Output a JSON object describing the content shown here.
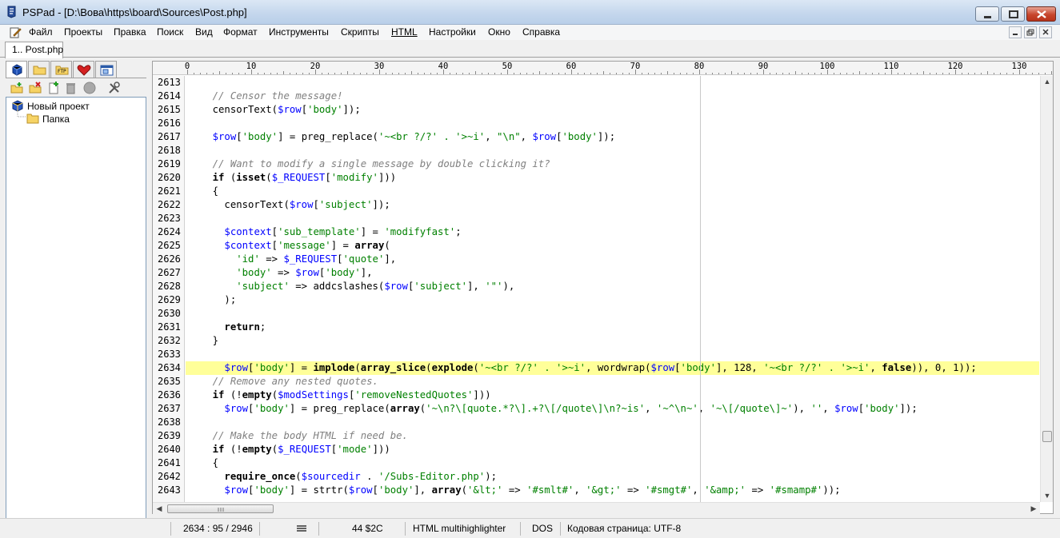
{
  "window": {
    "title": "PSPad - [D:\\Вова\\https\\board\\Sources\\Post.php]"
  },
  "menu": [
    "Файл",
    "Проекты",
    "Правка",
    "Поиск",
    "Вид",
    "Формат",
    "Инструменты",
    "Скрипты",
    "HTML",
    "Настройки",
    "Окно",
    "Справка"
  ],
  "tabs": {
    "document": "1.. Post.php"
  },
  "project_tree": {
    "project_label": "Новый проект",
    "folder_label": "Папка"
  },
  "ruler": {
    "labels": [
      "0",
      "10",
      "20",
      "30",
      "40",
      "50",
      "60",
      "70",
      "80",
      "90",
      "100",
      "110",
      "120",
      "130"
    ]
  },
  "editor": {
    "lines": [
      {
        "n": "2613",
        "segs": []
      },
      {
        "n": "2614",
        "segs": [
          [
            "",
            "    "
          ],
          [
            "cmt",
            "// Censor the message!"
          ]
        ]
      },
      {
        "n": "2615",
        "segs": [
          [
            "",
            "    censorText("
          ],
          [
            "var",
            "$row"
          ],
          [
            "",
            "["
          ],
          [
            "str",
            "'body'"
          ],
          [
            "",
            "]);"
          ]
        ]
      },
      {
        "n": "2616",
        "segs": []
      },
      {
        "n": "2617",
        "segs": [
          [
            "",
            "    "
          ],
          [
            "var",
            "$row"
          ],
          [
            "",
            "["
          ],
          [
            "str",
            "'body'"
          ],
          [
            "",
            "] = preg_replace("
          ],
          [
            "str",
            "'~<br ?/?' . '>~i'"
          ],
          [
            "",
            ", "
          ],
          [
            "str",
            "\"\\n\""
          ],
          [
            "",
            ", "
          ],
          [
            "var",
            "$row"
          ],
          [
            "",
            "["
          ],
          [
            "str",
            "'body'"
          ],
          [
            "",
            "]);"
          ]
        ]
      },
      {
        "n": "2618",
        "segs": []
      },
      {
        "n": "2619",
        "segs": [
          [
            "",
            "    "
          ],
          [
            "cmt",
            "// Want to modify a single message by double clicking it?"
          ]
        ]
      },
      {
        "n": "2620",
        "segs": [
          [
            "",
            "    "
          ],
          [
            "kw",
            "if"
          ],
          [
            "",
            " ("
          ],
          [
            "kw",
            "isset"
          ],
          [
            "",
            "("
          ],
          [
            "var",
            "$_REQUEST"
          ],
          [
            "",
            "["
          ],
          [
            "str",
            "'modify'"
          ],
          [
            "",
            "]))"
          ]
        ]
      },
      {
        "n": "2621",
        "segs": [
          [
            "",
            "    {"
          ]
        ]
      },
      {
        "n": "2622",
        "segs": [
          [
            "",
            "      censorText("
          ],
          [
            "var",
            "$row"
          ],
          [
            "",
            "["
          ],
          [
            "str",
            "'subject'"
          ],
          [
            "",
            "]);"
          ]
        ]
      },
      {
        "n": "2623",
        "segs": []
      },
      {
        "n": "2624",
        "segs": [
          [
            "",
            "      "
          ],
          [
            "var",
            "$context"
          ],
          [
            "",
            "["
          ],
          [
            "str",
            "'sub_template'"
          ],
          [
            "",
            "] = "
          ],
          [
            "str",
            "'modifyfast'"
          ],
          [
            "",
            ";"
          ]
        ]
      },
      {
        "n": "2625",
        "segs": [
          [
            "",
            "      "
          ],
          [
            "var",
            "$context"
          ],
          [
            "",
            "["
          ],
          [
            "str",
            "'message'"
          ],
          [
            "",
            "] = "
          ],
          [
            "kw",
            "array"
          ],
          [
            "",
            "("
          ]
        ]
      },
      {
        "n": "2626",
        "segs": [
          [
            "",
            "        "
          ],
          [
            "str",
            "'id'"
          ],
          [
            "",
            " => "
          ],
          [
            "var",
            "$_REQUEST"
          ],
          [
            "",
            "["
          ],
          [
            "str",
            "'quote'"
          ],
          [
            "",
            "],"
          ]
        ]
      },
      {
        "n": "2627",
        "segs": [
          [
            "",
            "        "
          ],
          [
            "str",
            "'body'"
          ],
          [
            "",
            " => "
          ],
          [
            "var",
            "$row"
          ],
          [
            "",
            "["
          ],
          [
            "str",
            "'body'"
          ],
          [
            "",
            "],"
          ]
        ]
      },
      {
        "n": "2628",
        "segs": [
          [
            "",
            "        "
          ],
          [
            "str",
            "'subject'"
          ],
          [
            "",
            " => addcslashes("
          ],
          [
            "var",
            "$row"
          ],
          [
            "",
            "["
          ],
          [
            "str",
            "'subject'"
          ],
          [
            "",
            "], "
          ],
          [
            "str",
            "'\"'"
          ],
          [
            "",
            "),"
          ]
        ]
      },
      {
        "n": "2629",
        "segs": [
          [
            "",
            "      );"
          ]
        ]
      },
      {
        "n": "2630",
        "segs": []
      },
      {
        "n": "2631",
        "segs": [
          [
            "",
            "      "
          ],
          [
            "kw",
            "return"
          ],
          [
            "",
            ";"
          ]
        ]
      },
      {
        "n": "2632",
        "segs": [
          [
            "",
            "    }"
          ]
        ]
      },
      {
        "n": "2633",
        "segs": []
      },
      {
        "n": "2634",
        "hl": true,
        "segs": [
          [
            "",
            "      "
          ],
          [
            "var",
            "$row"
          ],
          [
            "",
            "["
          ],
          [
            "str",
            "'body'"
          ],
          [
            "",
            "] = "
          ],
          [
            "kw",
            "implode"
          ],
          [
            "",
            "("
          ],
          [
            "kw",
            "array_slice"
          ],
          [
            "",
            "("
          ],
          [
            "kw",
            "explode"
          ],
          [
            "",
            "("
          ],
          [
            "str",
            "'~<br ?/?' . '>~i'"
          ],
          [
            "",
            ", wordwrap("
          ],
          [
            "var",
            "$row"
          ],
          [
            "",
            "["
          ],
          [
            "str",
            "'body'"
          ],
          [
            "",
            "], 128, "
          ],
          [
            "str",
            "'~<br ?/?' . '>~i'"
          ],
          [
            "",
            ", "
          ],
          [
            "kw",
            "false"
          ],
          [
            "",
            ")), 0, 1));"
          ]
        ]
      },
      {
        "n": "2635",
        "segs": [
          [
            "",
            "    "
          ],
          [
            "cmt",
            "// Remove any nested quotes."
          ]
        ]
      },
      {
        "n": "2636",
        "segs": [
          [
            "",
            "    "
          ],
          [
            "kw",
            "if"
          ],
          [
            "",
            " (!"
          ],
          [
            "kw",
            "empty"
          ],
          [
            "",
            "("
          ],
          [
            "var",
            "$modSettings"
          ],
          [
            "",
            "["
          ],
          [
            "str",
            "'removeNestedQuotes'"
          ],
          [
            "",
            "]))"
          ]
        ]
      },
      {
        "n": "2637",
        "segs": [
          [
            "",
            "      "
          ],
          [
            "var",
            "$row"
          ],
          [
            "",
            "["
          ],
          [
            "str",
            "'body'"
          ],
          [
            "",
            "] = preg_replace("
          ],
          [
            "kw",
            "array"
          ],
          [
            "",
            "("
          ],
          [
            "str",
            "'~\\n?\\[quote.*?\\].+?\\[/quote\\]\\n?~is'"
          ],
          [
            "",
            ", "
          ],
          [
            "str",
            "'~^\\n~'"
          ],
          [
            "",
            ", "
          ],
          [
            "str",
            "'~\\[/quote\\]~'"
          ],
          [
            "",
            "), "
          ],
          [
            "str",
            "''"
          ],
          [
            "",
            ", "
          ],
          [
            "var",
            "$row"
          ],
          [
            "",
            "["
          ],
          [
            "str",
            "'body'"
          ],
          [
            "",
            "]);"
          ]
        ]
      },
      {
        "n": "2638",
        "segs": []
      },
      {
        "n": "2639",
        "segs": [
          [
            "",
            "    "
          ],
          [
            "cmt",
            "// Make the body HTML if need be."
          ]
        ]
      },
      {
        "n": "2640",
        "segs": [
          [
            "",
            "    "
          ],
          [
            "kw",
            "if"
          ],
          [
            "",
            " (!"
          ],
          [
            "kw",
            "empty"
          ],
          [
            "",
            "("
          ],
          [
            "var",
            "$_REQUEST"
          ],
          [
            "",
            "["
          ],
          [
            "str",
            "'mode'"
          ],
          [
            "",
            "]))"
          ]
        ]
      },
      {
        "n": "2641",
        "segs": [
          [
            "",
            "    {"
          ]
        ]
      },
      {
        "n": "2642",
        "segs": [
          [
            "",
            "      "
          ],
          [
            "kw",
            "require_once"
          ],
          [
            "",
            "("
          ],
          [
            "var",
            "$sourcedir"
          ],
          [
            "",
            " . "
          ],
          [
            "str",
            "'/Subs-Editor.php'"
          ],
          [
            "",
            ");"
          ]
        ]
      },
      {
        "n": "2643",
        "segs": [
          [
            "",
            "      "
          ],
          [
            "var",
            "$row"
          ],
          [
            "",
            "["
          ],
          [
            "str",
            "'body'"
          ],
          [
            "",
            "] = strtr("
          ],
          [
            "var",
            "$row"
          ],
          [
            "",
            "["
          ],
          [
            "str",
            "'body'"
          ],
          [
            "",
            "], "
          ],
          [
            "kw",
            "array"
          ],
          [
            "",
            "("
          ],
          [
            "str",
            "'&lt;'"
          ],
          [
            "",
            " => "
          ],
          [
            "str",
            "'#smlt#'"
          ],
          [
            "",
            ", "
          ],
          [
            "str",
            "'&gt;'"
          ],
          [
            "",
            " => "
          ],
          [
            "str",
            "'#smgt#'"
          ],
          [
            "",
            ", "
          ],
          [
            "str",
            "'&amp;'"
          ],
          [
            "",
            " => "
          ],
          [
            "str",
            "'#smamp#'"
          ],
          [
            "",
            "));"
          ]
        ]
      }
    ]
  },
  "statusbar": {
    "position": "2634 : 95 / 2946",
    "char_info": "44  $2C",
    "highlighter": "HTML multihighlighter",
    "line_ending": "DOS",
    "codepage": "Кодовая страница: UTF-8"
  },
  "colors": {
    "highlight_line": "#ffff99",
    "keyword": "#000000",
    "variable": "#0000ff",
    "string": "#008000",
    "comment": "#808080"
  }
}
